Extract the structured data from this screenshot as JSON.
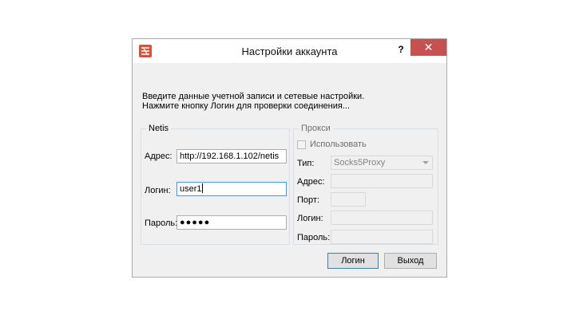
{
  "window": {
    "title": "Настройки аккаунта",
    "help": "?",
    "close": "✕"
  },
  "description": {
    "line1": "Введите данные учетной записи и сетевые настройки.",
    "line2": "Нажмите кнопку Логин для проверки соединения..."
  },
  "netis": {
    "legend": "Netis",
    "address_label": "Адрес:",
    "address_value": "http://192.168.1.102/netis",
    "login_label": "Логин:",
    "login_value": "user1",
    "password_label": "Пароль:",
    "password_value": "●●●●●"
  },
  "proxy": {
    "legend": "Прокси",
    "use_label": "Использовать",
    "use_checked": false,
    "type_label": "Тип:",
    "type_value": "Socks5Proxy",
    "address_label": "Адрес:",
    "port_label": "Порт:",
    "login_label": "Логин:",
    "password_label": "Пароль:"
  },
  "buttons": {
    "login": "Логин",
    "exit": "Выход"
  },
  "colors": {
    "close": "#c75050",
    "focus": "#3399ff",
    "app_icon": "#d9503b"
  }
}
